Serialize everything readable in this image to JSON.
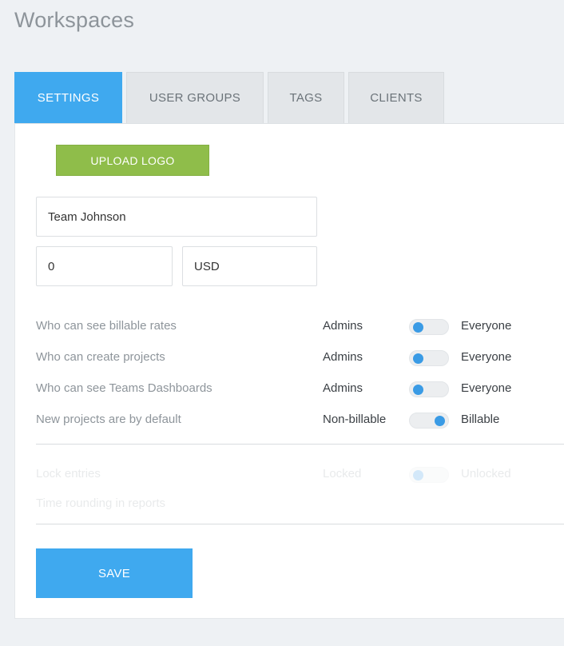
{
  "page": {
    "title": "Workspaces"
  },
  "tabs": [
    {
      "label": "SETTINGS",
      "active": true
    },
    {
      "label": "USER GROUPS",
      "active": false
    },
    {
      "label": "TAGS",
      "active": false
    },
    {
      "label": "CLIENTS",
      "active": false
    }
  ],
  "settings": {
    "upload_logo_label": "UPLOAD LOGO",
    "workspace_name": "Team Johnson",
    "rate_value": "0",
    "currency_value": "USD",
    "rows": [
      {
        "label": "Who can see billable rates",
        "left_option": "Admins",
        "right_option": "Everyone",
        "toggle_state": "left"
      },
      {
        "label": "Who can create projects",
        "left_option": "Admins",
        "right_option": "Everyone",
        "toggle_state": "left"
      },
      {
        "label": "Who can see Teams Dashboards",
        "left_option": "Admins",
        "right_option": "Everyone",
        "toggle_state": "left"
      },
      {
        "label": "New projects are by default",
        "left_option": "Non-billable",
        "right_option": "Billable",
        "toggle_state": "right"
      }
    ],
    "disabled_rows": [
      {
        "label": "Lock entries",
        "left_option": "Locked",
        "right_option": "Unlocked",
        "toggle_state": "left"
      },
      {
        "label": "Time rounding in reports"
      }
    ],
    "save_label": "SAVE"
  },
  "colors": {
    "accent": "#3fa9ef",
    "upload_button": "#8fbd4a",
    "toggle_knob": "#3a9be5"
  }
}
